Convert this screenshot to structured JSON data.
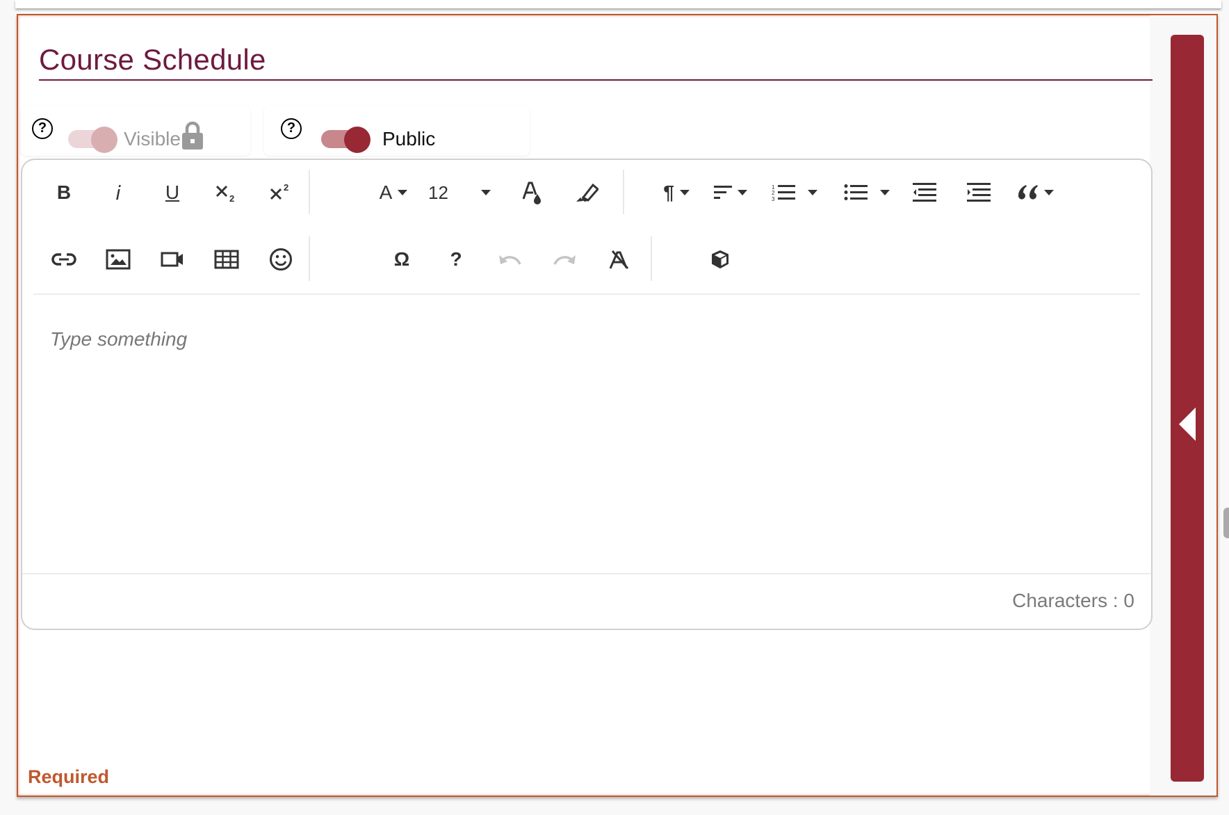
{
  "section": {
    "title": "Course Schedule",
    "required_label": "Required"
  },
  "toggles": [
    {
      "label": "Visible",
      "state": "on",
      "disabled": true,
      "locked": true,
      "help_icon": "question-circle-icon"
    },
    {
      "label": "Public",
      "state": "on",
      "disabled": false,
      "locked": false,
      "help_icon": "question-circle-icon"
    }
  ],
  "toolbar": {
    "row1": [
      {
        "name": "bold",
        "glyph": "B"
      },
      {
        "name": "italic",
        "glyph": "i"
      },
      {
        "name": "underline",
        "glyph": "U"
      },
      {
        "name": "subscript",
        "glyph": "x₂"
      },
      {
        "name": "superscript",
        "glyph": "x²"
      },
      {
        "name": "font-family",
        "glyph": "A",
        "dropdown": true
      },
      {
        "name": "font-size",
        "value": "12",
        "dropdown": true
      },
      {
        "name": "text-color"
      },
      {
        "name": "background-color"
      },
      {
        "name": "paragraph-format",
        "glyph": "¶",
        "dropdown": true
      },
      {
        "name": "align",
        "dropdown": true
      },
      {
        "name": "ordered-list",
        "dropdown": true
      },
      {
        "name": "unordered-list",
        "dropdown": true
      },
      {
        "name": "outdent"
      },
      {
        "name": "indent"
      },
      {
        "name": "quote",
        "glyph": "66",
        "dropdown": true
      }
    ],
    "row2": [
      {
        "name": "insert-link"
      },
      {
        "name": "insert-image"
      },
      {
        "name": "insert-video"
      },
      {
        "name": "insert-table"
      },
      {
        "name": "emoticons"
      },
      {
        "name": "special-characters",
        "glyph": "Ω"
      },
      {
        "name": "help",
        "glyph": "?"
      },
      {
        "name": "undo",
        "disabled": true
      },
      {
        "name": "redo",
        "disabled": true
      },
      {
        "name": "clear-formatting"
      },
      {
        "name": "embed-code"
      }
    ],
    "font_size_value": "12",
    "bold_glyph": "B",
    "italic_glyph": "i",
    "underline_glyph": "U",
    "font_glyph": "A",
    "paragraph_glyph": "¶",
    "omega_glyph": "Ω",
    "help_glyph": "?",
    "quote_glyph": "66"
  },
  "editor": {
    "placeholder": "Type something",
    "character_count_label": "Characters : 0"
  },
  "colors": {
    "brand": "#982834",
    "title": "#6e1a3f",
    "error": "#c0582e"
  }
}
